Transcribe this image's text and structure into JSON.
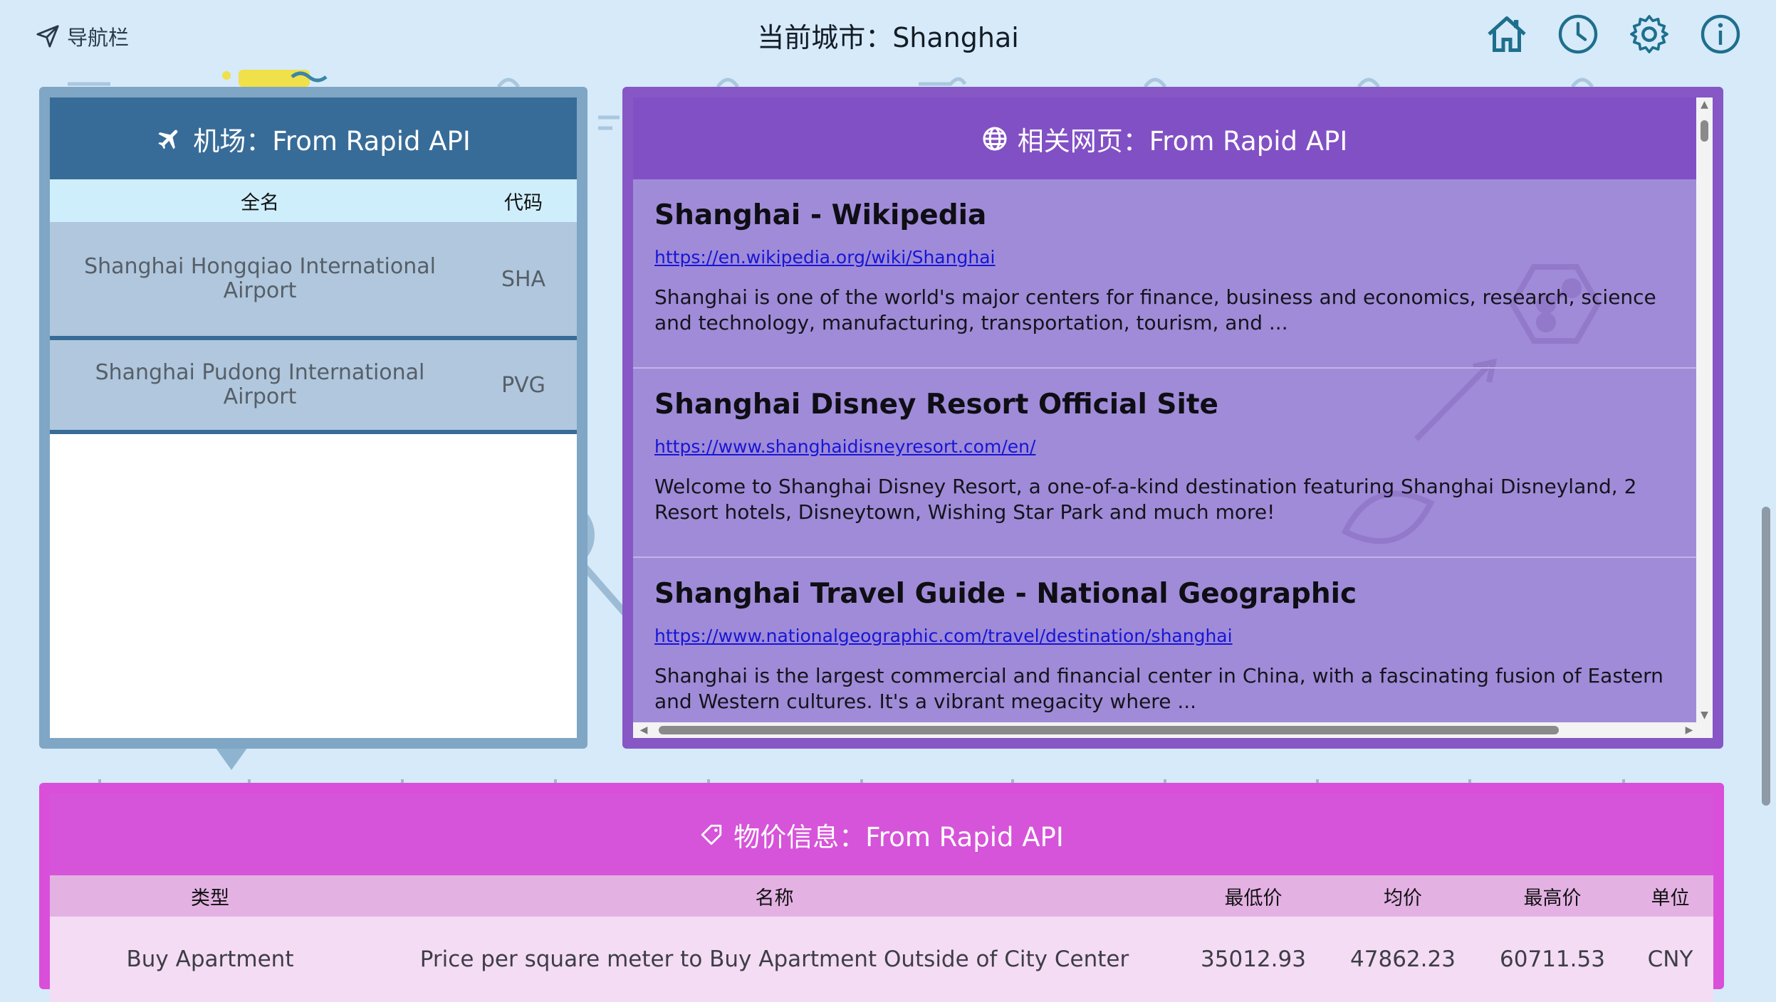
{
  "header": {
    "nav_label": "导航栏",
    "city_title": "当前城市：Shanghai",
    "icons": [
      "home-icon",
      "clock-icon",
      "gear-icon",
      "info-icon"
    ]
  },
  "airport": {
    "title": "机场：From Rapid API",
    "columns": {
      "name": "全名",
      "code": "代码"
    },
    "rows": [
      {
        "name": "Shanghai Hongqiao International Airport",
        "code": "SHA"
      },
      {
        "name": "Shanghai Pudong International Airport",
        "code": "PVG"
      }
    ]
  },
  "web": {
    "title": "相关网页：From Rapid API",
    "items": [
      {
        "title": "Shanghai - Wikipedia",
        "url": "https://en.wikipedia.org/wiki/Shanghai",
        "desc": "Shanghai is one of the world's major centers for finance, business and economics, research, science and technology, manufacturing, transportation, tourism, and ..."
      },
      {
        "title": "Shanghai Disney Resort Official Site",
        "url": "https://www.shanghaidisneyresort.com/en/",
        "desc": "Welcome to Shanghai Disney Resort, a one-of-a-kind destination featuring Shanghai Disneyland, 2 Resort hotels, Disneytown, Wishing Star Park and much more!"
      },
      {
        "title": "Shanghai Travel Guide - National Geographic",
        "url": "https://www.nationalgeographic.com/travel/destination/shanghai",
        "desc": "Shanghai is the largest commercial and financial center in China, with a fascinating fusion of Eastern and Western cultures. It's a vibrant megacity where ..."
      }
    ]
  },
  "prices": {
    "title": "物价信息：From Rapid API",
    "columns": {
      "type": "类型",
      "name": "名称",
      "min": "最低价",
      "avg": "均价",
      "max": "最高价",
      "unit": "单位"
    },
    "rows": [
      {
        "type": "Buy Apartment",
        "name": "Price per square meter to Buy Apartment Outside of City Center",
        "min": "35012.93",
        "avg": "47862.23",
        "max": "60711.53",
        "unit": "CNY"
      }
    ]
  },
  "colors": {
    "background": "#d6eafa",
    "airport_header": "#386c98",
    "web_header": "#8250c5",
    "price_header": "#d654d9"
  }
}
